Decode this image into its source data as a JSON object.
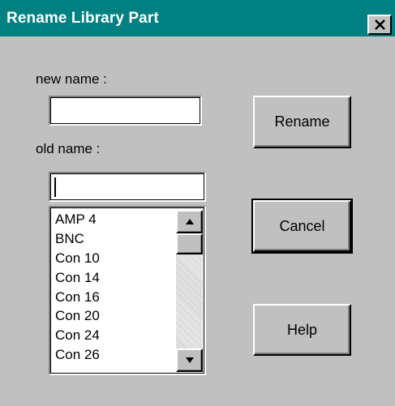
{
  "window": {
    "title": "Rename Library Part"
  },
  "form": {
    "new_name_label": "new name :",
    "new_name_value": "",
    "old_name_label": "old name :",
    "old_name_value": ""
  },
  "old_name_list": {
    "items": [
      "AMP 4",
      "BNC",
      "Con 10",
      "Con 14",
      "Con 16",
      "Con 20",
      "Con 24",
      "Con 26"
    ]
  },
  "buttons": {
    "rename": "Rename",
    "cancel": "Cancel",
    "help": "Help"
  },
  "icons": {
    "close": "close-icon",
    "scroll_up": "arrow-up-icon",
    "scroll_down": "arrow-down-icon"
  },
  "colors": {
    "titlebar": "#008080",
    "face": "#c0c0c0"
  }
}
